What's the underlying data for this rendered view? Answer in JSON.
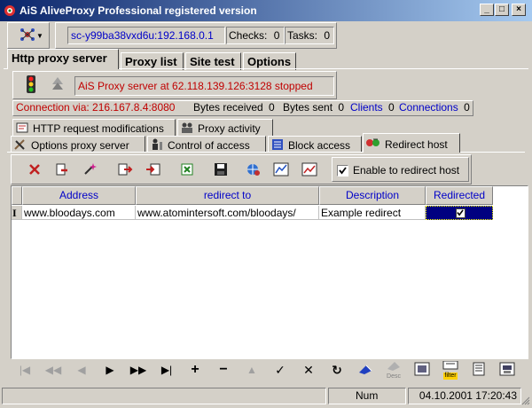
{
  "window": {
    "title": "AiS AliveProxy Professional registered version",
    "buttons": [
      "_",
      "□",
      "×"
    ]
  },
  "header": {
    "machine": "sc-y99ba38vxd6u:192.168.0.1",
    "checks_label": "Checks:",
    "checks_value": "0",
    "tasks_label": "Tasks:",
    "tasks_value": "0"
  },
  "main_tabs": [
    "Http proxy server",
    "Proxy list",
    "Site test",
    "Options"
  ],
  "server_status": "AiS Proxy server at 62.118.139.126:3128 stopped",
  "connection_bar": {
    "connection": "Connection via: 216.167.8.4:8080",
    "bytes_received_label": "Bytes received",
    "bytes_received_value": "0",
    "bytes_sent_label": "Bytes sent",
    "bytes_sent_value": "0",
    "clients_label": "Clients",
    "clients_value": "0",
    "connections_label": "Connections",
    "connections_value": "0"
  },
  "sub_tabs_row1": [
    "HTTP request modifications",
    "Proxy activity"
  ],
  "sub_tabs_row2": [
    "Options proxy server",
    "Control of access",
    "Block access",
    "Redirect host"
  ],
  "toolbar": {
    "enable_label": "Enable to redirect host",
    "enable_checked": true
  },
  "grid": {
    "columns": [
      "Address",
      "redirect to",
      "Description",
      "Redirected"
    ],
    "rows": [
      {
        "address": "www.bloodays.com",
        "redirect_to": "www.atomintersoft.com/bloodays/",
        "description": "Example redirect",
        "redirected": true
      }
    ]
  },
  "navigator": {
    "buttons": [
      "first",
      "prior",
      "previous",
      "next",
      "next-page",
      "last",
      "insert",
      "delete",
      "edit",
      "post",
      "cancel",
      "refresh"
    ],
    "glyphs": [
      "|◀",
      "◀◀",
      "◀",
      "▶",
      "▶▶",
      "▶|",
      "+",
      "−",
      "▲",
      "✓",
      "✕",
      "↻"
    ]
  },
  "extra_tools": {
    "desc_label": "Desc",
    "filter_label": "filter"
  },
  "statusbar": {
    "num": "Num",
    "datetime": "04.10.2001 17:20:43"
  },
  "colors": {
    "title_start": "#0a246a",
    "title_end": "#a6caf0",
    "accent_blue": "#0000c8",
    "alert_red": "#c00000",
    "selection": "#000080"
  }
}
